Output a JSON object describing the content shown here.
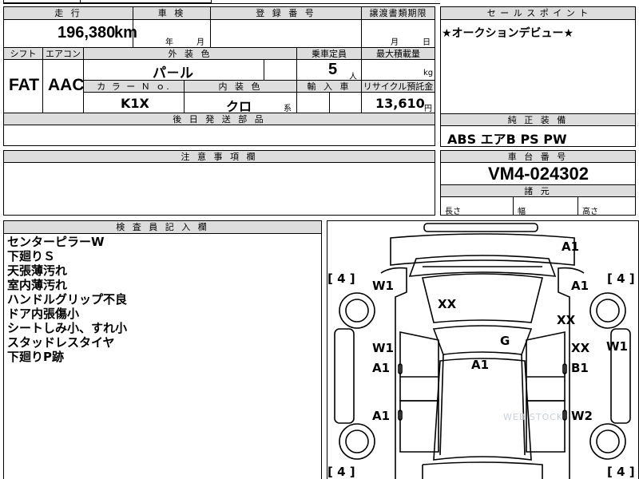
{
  "headers": {
    "mileage": "走 行",
    "inspection": "車 検",
    "registration": "登 録 番 号",
    "transfer_deadline": "譲渡書類期限",
    "sales_point": "セ ー ル ス ポ イ ン ト",
    "shift": "シフト",
    "aircon": "エアコン",
    "exterior_color": "外 装 色",
    "capacity": "乗車定員",
    "max_load": "最大積載量",
    "color_no": "カ ラ ー Ｎ ｏ.",
    "interior_color": "内 装 色",
    "import": "輸 入 車",
    "recycle": "リサイクル預託金",
    "later_parts": "後 日 発 送 部 品",
    "equipment": "純 正 装 備",
    "notes": "注 意 事 項 欄",
    "chassis_no": "車 台 番 号",
    "dimensions": "諸 元",
    "inspector": "検 査 員 記 入 欄"
  },
  "values": {
    "mileage": "196,380",
    "mileage_unit": "km",
    "inspection_year": "年",
    "inspection_month": "月",
    "deadline_month": "月",
    "deadline_day": "日",
    "sales_point": "★オークションデビュー★",
    "shift": "FAT",
    "aircon": "AAC",
    "exterior_color": "パ－ル",
    "capacity": "5",
    "capacity_unit": "人",
    "load_unit": "kg",
    "color_no": "K1X",
    "interior_color": "クロ",
    "interior_suffix": "系",
    "recycle": "13,610",
    "recycle_unit": "円",
    "equipment": "ABS エアB PS PW",
    "chassis_no": "VM4-024302",
    "length": "長さ",
    "width": "幅",
    "height": "高さ"
  },
  "inspector_notes": [
    "センターピラーW",
    "下廻りＳ",
    "天張薄汚れ",
    "室内薄汚れ",
    "ハンドルグリップ不良",
    "ドア内張傷小",
    "シートしみ小、すれ小",
    "スタッドレスタイヤ",
    "下廻りP跡"
  ],
  "diagram": {
    "tire_marks": [
      "[ 4 ]",
      "[ 4 ]",
      "[ 4 ]",
      "[ 4 ]"
    ],
    "damage_marks": [
      "A1",
      "W1",
      "A1",
      "XX",
      "XX",
      "W1",
      "XX",
      "W1",
      "G",
      "A1",
      "A1",
      "B1",
      "A1",
      "W2"
    ],
    "watermark": "WEB STOCK"
  }
}
